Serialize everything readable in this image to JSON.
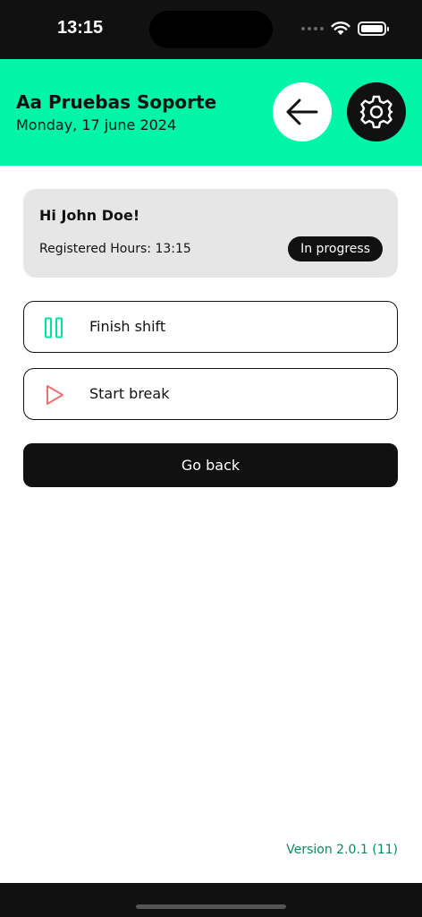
{
  "status_bar": {
    "time": "13:15"
  },
  "header": {
    "title": "Aa Pruebas Soporte",
    "date": "Monday, 17 june 2024",
    "back_icon": "arrow-left-icon",
    "settings_icon": "gear-icon",
    "background_color": "#00f5a6"
  },
  "greeting_card": {
    "greeting": "Hi John Doe!",
    "registered_hours": "Registered Hours: 13:15",
    "status": "In progress"
  },
  "actions": {
    "finish_shift": {
      "label": "Finish shift",
      "icon": "pause-icon",
      "icon_color": "#00e39a"
    },
    "start_break": {
      "label": "Start break",
      "icon": "play-icon",
      "icon_color": "#f07070"
    },
    "go_back": {
      "label": "Go back"
    }
  },
  "footer": {
    "version": "Version 2.0.1 (11)"
  }
}
